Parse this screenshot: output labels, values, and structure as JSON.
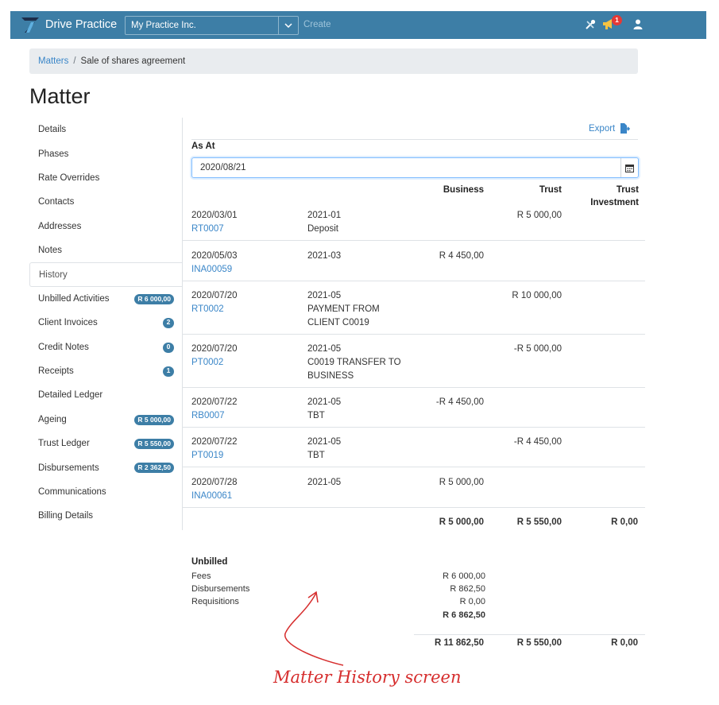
{
  "app": {
    "brand": "Drive Practice",
    "practice_name": "My Practice Inc.",
    "create_label": "Create",
    "notification_count": "1",
    "brand_color": "#3d7ea6",
    "link_color": "#3a86c8"
  },
  "breadcrumb": {
    "parent": "Matters",
    "separator": "/",
    "current": "Sale of shares agreement"
  },
  "page_title": "Matter",
  "sidebar": {
    "items": [
      {
        "label": "Details"
      },
      {
        "label": "Phases"
      },
      {
        "label": "Rate Overrides"
      },
      {
        "label": "Contacts"
      },
      {
        "label": "Addresses"
      },
      {
        "label": "Notes"
      },
      {
        "label": "History",
        "active": true
      },
      {
        "label": "Unbilled Activities",
        "badge": "R 6 000,00"
      },
      {
        "label": "Client Invoices",
        "badge": "2"
      },
      {
        "label": "Credit Notes",
        "badge": "0"
      },
      {
        "label": "Receipts",
        "badge": "1"
      },
      {
        "label": "Detailed Ledger"
      },
      {
        "label": "Ageing",
        "badge": "R 5 000,00"
      },
      {
        "label": "Trust Ledger",
        "badge": "R 5 550,00"
      },
      {
        "label": "Disbursements",
        "badge": "R 2 362,50"
      },
      {
        "label": "Communications"
      },
      {
        "label": "Billing Details"
      }
    ]
  },
  "history": {
    "export_label": "Export",
    "as_at_label": "As At",
    "as_at_value": "2020/08/21",
    "columns": {
      "business": "Business",
      "trust": "Trust",
      "trust_investment_1": "Trust",
      "trust_investment_2": "Investment"
    },
    "rows": [
      {
        "date": "2020/03/01",
        "ref": "RT0007",
        "desc": [
          "2021-01",
          "Deposit"
        ],
        "business": "",
        "trust": "R 5 000,00",
        "investment": ""
      },
      {
        "date": "2020/05/03",
        "ref": "INA00059",
        "desc": [
          "2021-03"
        ],
        "business": "R 4 450,00",
        "trust": "",
        "investment": ""
      },
      {
        "date": "2020/07/20",
        "ref": "RT0002",
        "desc": [
          "2021-05",
          "PAYMENT FROM",
          "CLIENT C0019"
        ],
        "business": "",
        "trust": "R 10 000,00",
        "investment": ""
      },
      {
        "date": "2020/07/20",
        "ref": "PT0002",
        "desc": [
          "2021-05",
          "C0019 TRANSFER TO",
          "BUSINESS"
        ],
        "business": "",
        "trust": "-R 5 000,00",
        "investment": ""
      },
      {
        "date": "2020/07/22",
        "ref": "RB0007",
        "desc": [
          "2021-05",
          "TBT"
        ],
        "business": "-R 4 450,00",
        "trust": "",
        "investment": ""
      },
      {
        "date": "2020/07/22",
        "ref": "PT0019",
        "desc": [
          "2021-05",
          "TBT"
        ],
        "business": "",
        "trust": "-R 4 450,00",
        "investment": ""
      },
      {
        "date": "2020/07/28",
        "ref": "INA00061",
        "desc": [
          "2021-05"
        ],
        "business": "R 5 000,00",
        "trust": "",
        "investment": ""
      }
    ],
    "totals": {
      "business": "R 5 000,00",
      "trust": "R 5 550,00",
      "investment": "R 0,00"
    },
    "unbilled": {
      "title": "Unbilled",
      "fees_label": "Fees",
      "fees": "R 6 000,00",
      "disb_label": "Disbursements",
      "disb": "R 862,50",
      "req_label": "Requisitions",
      "req": "R 0,00",
      "subtotal": "R 6 862,50"
    },
    "grand_totals": {
      "business": "R 11 862,50",
      "trust": "R 5 550,00",
      "investment": "R 0,00"
    }
  },
  "annotation": "Matter History screen"
}
